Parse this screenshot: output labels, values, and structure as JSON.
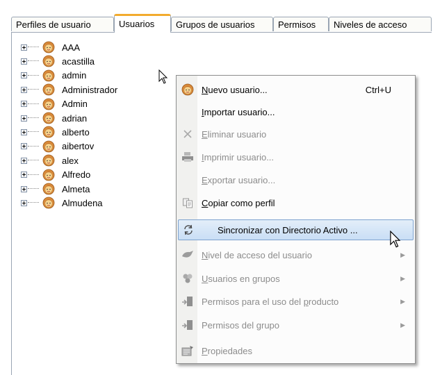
{
  "tabs": [
    {
      "label": "Perfiles de usuario"
    },
    {
      "label": "Usuarios",
      "active": true
    },
    {
      "label": "Grupos de usuarios"
    },
    {
      "label": "Permisos"
    },
    {
      "label": "Niveles de acceso"
    }
  ],
  "users": [
    "AAA",
    "acastilla",
    "admin",
    "Administrador",
    "Admin",
    "adrian",
    "alberto",
    "aibertov",
    "alex",
    "Alfredo",
    "Almeta",
    "Almudena"
  ],
  "menu": {
    "items": [
      {
        "pre": "",
        "ul": "N",
        "post": "uevo usuario...",
        "shortcut": "Ctrl+U",
        "enabled": true,
        "icon": "user-icon"
      },
      {
        "pre": "",
        "ul": "I",
        "post": "mportar usuario...",
        "enabled": true,
        "icon": ""
      },
      {
        "pre": "",
        "ul": "E",
        "post": "liminar usuario",
        "enabled": false,
        "icon": "delete-x-icon"
      },
      {
        "pre": "",
        "ul": "I",
        "post": "mprimir usuario...",
        "enabled": false,
        "icon": "printer-icon"
      },
      {
        "pre": "",
        "ul": "E",
        "post": "xportar usuario...",
        "enabled": false,
        "icon": ""
      },
      {
        "pre": "",
        "ul": "C",
        "post": "opiar como perfil",
        "enabled": true,
        "icon": "copy-icon"
      },
      {
        "pre": "Sincronizar con Directorio Activo ...",
        "ul": "",
        "post": "",
        "enabled": true,
        "highlighted": true,
        "icon": "sync-icon"
      },
      {
        "pre": "",
        "ul": "N",
        "post": "ivel de acceso del usuario",
        "enabled": false,
        "submenu": true,
        "icon": "access-level-icon"
      },
      {
        "pre": "",
        "ul": "U",
        "post": "suarios en grupos",
        "enabled": false,
        "submenu": true,
        "icon": "groups-icon"
      },
      {
        "pre": "Permisos para el uso del ",
        "ul": "p",
        "post": "roducto",
        "enabled": false,
        "submenu": true,
        "icon": "product-permissions-icon"
      },
      {
        "pre": "Permisos del ",
        "ul": "g",
        "post": "rupo",
        "enabled": false,
        "submenu": true,
        "icon": "group-permissions-icon"
      },
      {
        "pre": "",
        "ul": "P",
        "post": "ropiedades",
        "enabled": false,
        "icon": "properties-icon"
      }
    ]
  },
  "colors": {
    "active_tab_accent": "#f2ab2e",
    "highlight_border": "#7da2ce",
    "disabled_text": "#8c8c8c"
  }
}
